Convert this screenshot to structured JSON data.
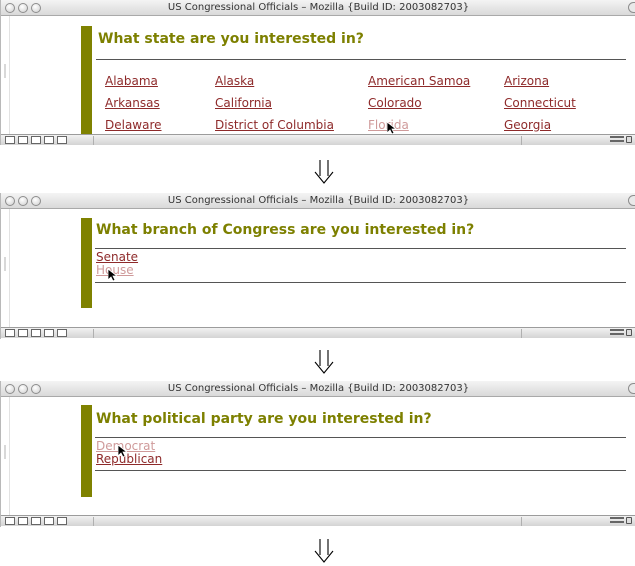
{
  "window_title": "US Congressional Officials – Mozilla {Build ID: 2003082703}",
  "panel1": {
    "heading": "What state are you interested in?",
    "states": [
      {
        "label": "Alabama",
        "visited": false
      },
      {
        "label": "Alaska",
        "visited": false
      },
      {
        "label": "American Samoa",
        "visited": false
      },
      {
        "label": "Arizona",
        "visited": false
      },
      {
        "label": "Arkansas",
        "visited": false
      },
      {
        "label": "California",
        "visited": false
      },
      {
        "label": "Colorado",
        "visited": false
      },
      {
        "label": "Connecticut",
        "visited": false
      },
      {
        "label": "Delaware",
        "visited": false
      },
      {
        "label": "District of Columbia",
        "visited": false
      },
      {
        "label": "Florida",
        "visited": true
      },
      {
        "label": "Georgia",
        "visited": false
      }
    ]
  },
  "panel2": {
    "heading": "What branch of Congress are you interested in?",
    "options": [
      {
        "label": "Senate",
        "visited": false
      },
      {
        "label": "House",
        "visited": true
      }
    ]
  },
  "panel3": {
    "heading": "What political party are you interested in?",
    "options": [
      {
        "label": "Democrat",
        "visited": true
      },
      {
        "label": "Republican",
        "visited": false
      }
    ]
  },
  "flow_arrow": "⇓",
  "status_icons": [
    "navigator-icon",
    "mail-icon",
    "composer-icon",
    "addressbook-icon",
    "chatzilla-icon"
  ],
  "colors": {
    "heading": "#7d8000",
    "bar": "#7f8200",
    "link": "#8e2a2a",
    "visited_link": "#cf9a9a"
  }
}
